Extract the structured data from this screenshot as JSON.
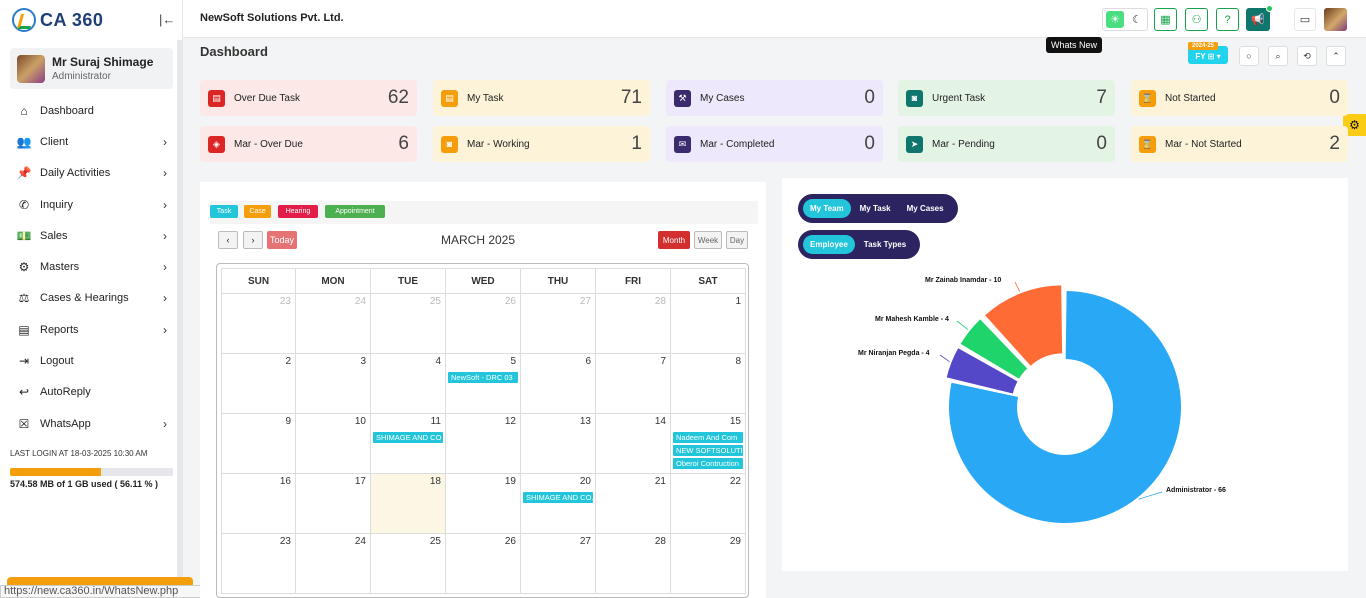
{
  "app": {
    "logo_text": "CA 360",
    "company": "NewSoft Solutions Pvt. Ltd."
  },
  "user": {
    "name": "Mr Suraj Shimage",
    "role": "Administrator"
  },
  "nav": [
    {
      "label": "Dashboard",
      "icon": "home-icon",
      "glyph": "⌂",
      "chevron": false
    },
    {
      "label": "Client",
      "icon": "users-icon",
      "glyph": "👥",
      "chevron": true
    },
    {
      "label": "Daily Activities",
      "icon": "pin-icon",
      "glyph": "📌",
      "chevron": true
    },
    {
      "label": "Inquiry",
      "icon": "phone-icon",
      "glyph": "✆",
      "chevron": true
    },
    {
      "label": "Sales",
      "icon": "money-icon",
      "glyph": "💵",
      "chevron": true
    },
    {
      "label": "Masters",
      "icon": "cogs-icon",
      "glyph": "⚙",
      "chevron": true
    },
    {
      "label": "Cases & Hearings",
      "icon": "scale-icon",
      "glyph": "⚖",
      "chevron": true
    },
    {
      "label": "Reports",
      "icon": "file-icon",
      "glyph": "▤",
      "chevron": true
    },
    {
      "label": "Logout",
      "icon": "logout-icon",
      "glyph": "⇥",
      "chevron": false
    },
    {
      "label": "AutoReply",
      "icon": "reply-icon",
      "glyph": "↩",
      "chevron": false
    },
    {
      "label": "WhatsApp",
      "icon": "whatsapp-icon",
      "glyph": "☒",
      "chevron": true
    }
  ],
  "login": {
    "last_login": "LAST LOGIN AT 18-03-2025 10:30 AM",
    "storage_text": "574.58 MB of 1 GB used ( 56.11 % )",
    "storage_pct": 56.11
  },
  "url_tip": "https://new.ca360.in/WhatsNew.php",
  "header": {
    "tooltip": "Whats New",
    "fy_year": "2024-25",
    "fy_label": "FY ⊞ ▾"
  },
  "page_title": "Dashboard",
  "cards": [
    {
      "label": "Over Due Task",
      "value": "62",
      "bg": "#fde8e8",
      "icon_bg": "#dc2626",
      "glyph": "▤",
      "icon": "task-icon"
    },
    {
      "label": "My Task",
      "value": "71",
      "bg": "#fdf3d8",
      "icon_bg": "#f59e0b",
      "glyph": "▤",
      "icon": "task-icon"
    },
    {
      "label": "My Cases",
      "value": "0",
      "bg": "#ede8fb",
      "icon_bg": "#3b2a6e",
      "glyph": "⚒",
      "icon": "gavel-icon"
    },
    {
      "label": "Urgent Task",
      "value": "7",
      "bg": "#e3f4e4",
      "icon_bg": "#0f766e",
      "glyph": "◙",
      "icon": "urgent-icon"
    },
    {
      "label": "Not Started",
      "value": "0",
      "bg": "#fdf3d8",
      "icon_bg": "#f59e0b",
      "glyph": "⌛",
      "icon": "hourglass-icon"
    },
    {
      "label": "Mar - Over Due",
      "value": "6",
      "bg": "#fde8e8",
      "icon_bg": "#dc2626",
      "glyph": "◈",
      "icon": "overdue-icon"
    },
    {
      "label": "Mar - Working",
      "value": "1",
      "bg": "#fdf3d8",
      "icon_bg": "#f59e0b",
      "glyph": "◙",
      "icon": "working-icon"
    },
    {
      "label": "Mar - Completed",
      "value": "0",
      "bg": "#ede8fb",
      "icon_bg": "#3b2a6e",
      "glyph": "✉",
      "icon": "completed-icon"
    },
    {
      "label": "Mar - Pending",
      "value": "0",
      "bg": "#e3f4e4",
      "icon_bg": "#0f766e",
      "glyph": "➤",
      "icon": "send-icon"
    },
    {
      "label": "Mar - Not Started",
      "value": "2",
      "bg": "#fdf3d8",
      "icon_bg": "#f59e0b",
      "glyph": "⌛",
      "icon": "hourglass-icon"
    }
  ],
  "calendar": {
    "legend": [
      {
        "label": "Task",
        "color": "#22c5d9"
      },
      {
        "label": "Case",
        "color": "#f59e0b"
      },
      {
        "label": "Hearing",
        "color": "#e11d48"
      },
      {
        "label": "Appointment",
        "color": "#4caf50"
      }
    ],
    "prev": "‹",
    "next": "›",
    "today_label": "Today",
    "title": "MARCH 2025",
    "views": [
      "Month",
      "Week",
      "Day"
    ],
    "days_of_week": [
      "SUN",
      "MON",
      "TUE",
      "WED",
      "THU",
      "FRI",
      "SAT"
    ],
    "weeks": [
      [
        {
          "d": "23",
          "m": true
        },
        {
          "d": "24",
          "m": true
        },
        {
          "d": "25",
          "m": true
        },
        {
          "d": "26",
          "m": true
        },
        {
          "d": "27",
          "m": true
        },
        {
          "d": "28",
          "m": true
        },
        {
          "d": "1",
          "m": false
        }
      ],
      [
        {
          "d": "2",
          "m": false
        },
        {
          "d": "3",
          "m": false
        },
        {
          "d": "4",
          "m": false
        },
        {
          "d": "5",
          "m": false,
          "events": [
            "NewSoft - DRC 03"
          ]
        },
        {
          "d": "6",
          "m": false
        },
        {
          "d": "7",
          "m": false
        },
        {
          "d": "8",
          "m": false
        }
      ],
      [
        {
          "d": "9",
          "m": false
        },
        {
          "d": "10",
          "m": false
        },
        {
          "d": "11",
          "m": false,
          "events": [
            "SHIMAGE AND CO"
          ]
        },
        {
          "d": "12",
          "m": false
        },
        {
          "d": "13",
          "m": false
        },
        {
          "d": "14",
          "m": false
        },
        {
          "d": "15",
          "m": false,
          "events": [
            "Nadeem And Com",
            "NEW SOFTSOLUTIO",
            "Oberoi Contruction"
          ]
        }
      ],
      [
        {
          "d": "16",
          "m": false
        },
        {
          "d": "17",
          "m": false
        },
        {
          "d": "18",
          "m": false,
          "today": true
        },
        {
          "d": "19",
          "m": false
        },
        {
          "d": "20",
          "m": false,
          "events": [
            "SHIMAGE AND CO."
          ]
        },
        {
          "d": "21",
          "m": false
        },
        {
          "d": "22",
          "m": false
        }
      ],
      [
        {
          "d": "23",
          "m": false
        },
        {
          "d": "24",
          "m": false
        },
        {
          "d": "25",
          "m": false
        },
        {
          "d": "26",
          "m": false
        },
        {
          "d": "27",
          "m": false
        },
        {
          "d": "28",
          "m": false
        },
        {
          "d": "29",
          "m": false
        }
      ]
    ]
  },
  "chart_tabs": {
    "row1": [
      {
        "label": "My Team",
        "active": true
      },
      {
        "label": "My Task",
        "active": false
      },
      {
        "label": "My Cases",
        "active": false
      }
    ],
    "row2": [
      {
        "label": "Employee",
        "active": true
      },
      {
        "label": "Task Types",
        "active": false
      }
    ]
  },
  "chart_data": {
    "type": "pie",
    "categories": [
      "Administrator",
      "Mr Niranjan Pegda",
      "Mr Mahesh Kamble",
      "Mr Zainab Inamdar"
    ],
    "values": [
      66,
      4,
      4,
      10
    ],
    "labels": [
      "Administrator - 66",
      "Mr Niranjan Pegda - 4",
      "Mr Mahesh Kamble - 4",
      "Mr Zainab Inamdar - 10"
    ],
    "colors": [
      "#29a9f5",
      "#5548c8",
      "#1fd46a",
      "#ff6b35"
    ],
    "donut": true
  }
}
